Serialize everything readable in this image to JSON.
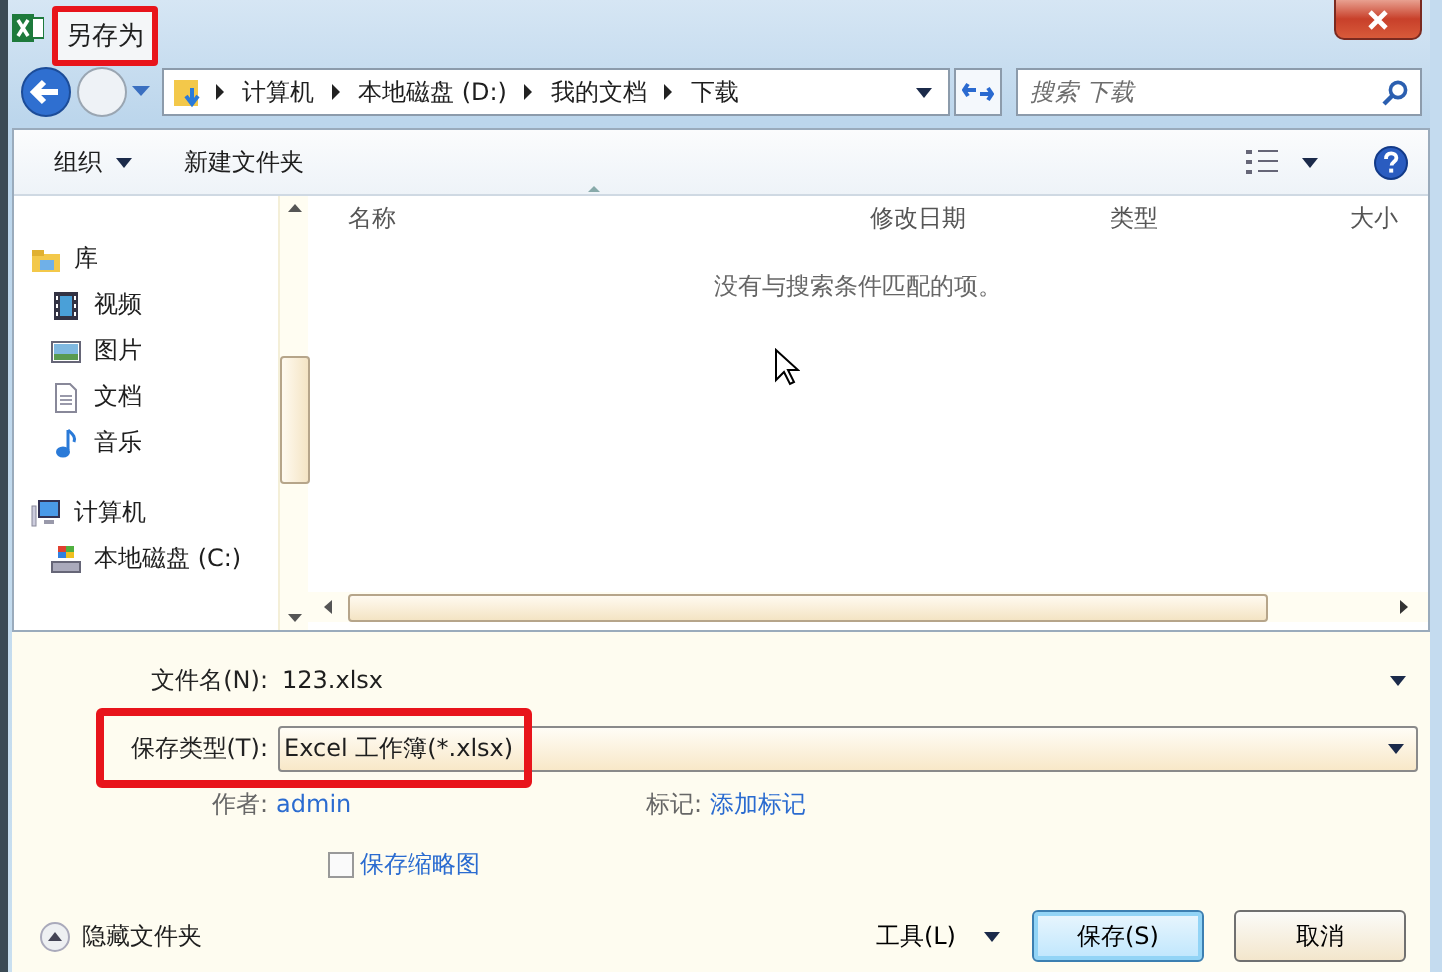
{
  "window": {
    "title": "另存为",
    "title_highlighted": true
  },
  "nav": {
    "breadcrumb": [
      "计算机",
      "本地磁盘 (D:)",
      "我的文档",
      "下载"
    ],
    "search": {
      "placeholder": "搜索 下载"
    }
  },
  "toolbar": {
    "buttons": [
      {
        "label": "组织",
        "kind": "menu"
      },
      {
        "label": "新建文件夹",
        "kind": "plain"
      }
    ]
  },
  "sidebar": {
    "items": [
      {
        "label": "库",
        "kind": "library",
        "children": [
          {
            "label": "视频",
            "kind": "video"
          },
          {
            "label": "图片",
            "kind": "picture"
          },
          {
            "label": "文档",
            "kind": "document"
          },
          {
            "label": "音乐",
            "kind": "music"
          }
        ]
      },
      {
        "label": "计算机",
        "kind": "computer",
        "children": [
          {
            "label": "本地磁盘 (C:)",
            "kind": "drive"
          }
        ]
      }
    ]
  },
  "table": {
    "columns": [
      "名称",
      "修改日期",
      "类型",
      "大小"
    ],
    "empty_message": "没有与搜索条件匹配的项。"
  },
  "form": {
    "fields": [
      {
        "label": "文件名(N):",
        "value": "123.xlsx",
        "kind": "combo",
        "highlighted": false
      },
      {
        "label": "保存类型(T):",
        "value": "Excel 工作簿(*.xlsx)",
        "kind": "dropdown",
        "highlighted": true
      }
    ],
    "meta": [
      {
        "label": "作者:",
        "value": "admin"
      },
      {
        "label": "标记:",
        "value": "添加标记"
      }
    ],
    "thumbnail_checkbox": {
      "label": "保存缩略图",
      "checked": false
    }
  },
  "footer": {
    "toggle": "隐藏文件夹",
    "tools": "工具(L)",
    "buttons": [
      {
        "label": "保存(S)",
        "default": true
      },
      {
        "label": "取消",
        "default": false
      }
    ]
  }
}
